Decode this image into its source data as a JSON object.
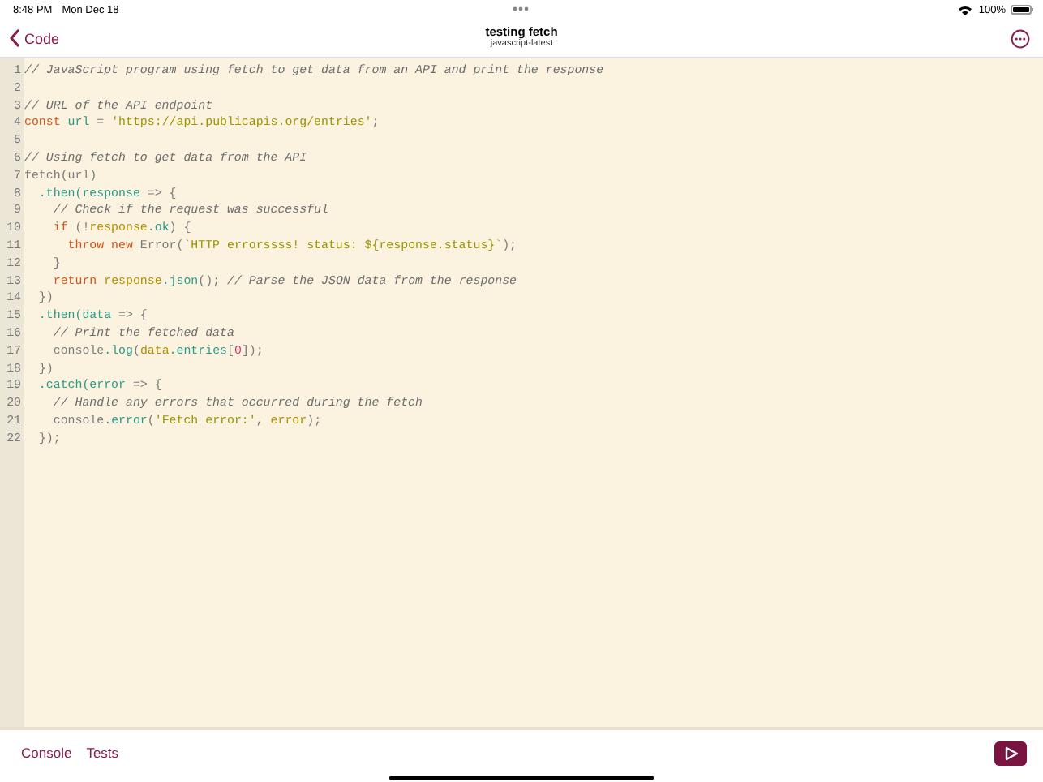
{
  "status_bar": {
    "time": "8:48 PM",
    "date": "Mon Dec 18",
    "battery": "100%"
  },
  "nav": {
    "back_label": "Code",
    "title": "testing fetch",
    "subtitle": "javascript-latest"
  },
  "editor": {
    "lines": [
      {
        "number": "1",
        "tokens": [
          {
            "kind": "comment",
            "text": "// JavaScript program using fetch to get data from an API and print the response"
          }
        ]
      },
      {
        "number": "2"
      },
      {
        "number": "3",
        "tokens": [
          {
            "kind": "comment",
            "text": "// URL of the API endpoint"
          }
        ]
      },
      {
        "number": "4",
        "tokens": [
          {
            "kind": "keyword",
            "text": "const"
          },
          {
            "kind": "member",
            "text": " url"
          },
          {
            "kind": "plain",
            "text": " = "
          },
          {
            "kind": "string",
            "text": "'https://api.publicapis.org/entries'"
          },
          {
            "kind": "plain",
            "text": ";"
          }
        ]
      },
      {
        "number": "5"
      },
      {
        "number": "6",
        "tokens": [
          {
            "kind": "comment",
            "text": "// Using fetch to get data from the API"
          }
        ]
      },
      {
        "number": "7",
        "tokens": [
          {
            "kind": "plain",
            "text": "fetch(url)"
          }
        ]
      },
      {
        "number": "8",
        "tokens": [
          {
            "kind": "member",
            "text": "  .then(response"
          },
          {
            "kind": "plain",
            "text": " => {"
          }
        ]
      },
      {
        "number": "9",
        "tokens": [
          {
            "kind": "comment",
            "text": "    // Check if the request was successful"
          }
        ]
      },
      {
        "number": "10",
        "tokens": [
          {
            "kind": "keyword",
            "text": "    if"
          },
          {
            "kind": "plain",
            "text": " (!"
          },
          {
            "kind": "variable",
            "text": "response"
          },
          {
            "kind": "member",
            "text": ".ok"
          },
          {
            "kind": "plain",
            "text": ") {"
          }
        ]
      },
      {
        "number": "11",
        "tokens": [
          {
            "kind": "keyword",
            "text": "      throw new"
          },
          {
            "kind": "plain",
            "text": " Error("
          },
          {
            "kind": "string",
            "text": "`HTTP errorssss! status: ${response.status}`"
          },
          {
            "kind": "plain",
            "text": ");"
          }
        ]
      },
      {
        "number": "12",
        "tokens": [
          {
            "kind": "plain",
            "text": "    }"
          }
        ]
      },
      {
        "number": "13",
        "tokens": [
          {
            "kind": "keyword",
            "text": "    return"
          },
          {
            "kind": "variable",
            "text": " response"
          },
          {
            "kind": "member",
            "text": ".json"
          },
          {
            "kind": "plain",
            "text": "();"
          },
          {
            "kind": "comment",
            "text": " // Parse the JSON data from the response"
          }
        ]
      },
      {
        "number": "14",
        "tokens": [
          {
            "kind": "plain",
            "text": "  })"
          }
        ]
      },
      {
        "number": "15",
        "tokens": [
          {
            "kind": "member",
            "text": "  .then(data"
          },
          {
            "kind": "plain",
            "text": " => {"
          }
        ]
      },
      {
        "number": "16",
        "tokens": [
          {
            "kind": "comment",
            "text": "    // Print the fetched data"
          }
        ]
      },
      {
        "number": "17",
        "tokens": [
          {
            "kind": "plain",
            "text": "    console"
          },
          {
            "kind": "member",
            "text": ".log"
          },
          {
            "kind": "plain",
            "text": "("
          },
          {
            "kind": "variable",
            "text": "data"
          },
          {
            "kind": "member",
            "text": ".entries"
          },
          {
            "kind": "plain",
            "text": "["
          },
          {
            "kind": "number",
            "text": "0"
          },
          {
            "kind": "plain",
            "text": "]);"
          }
        ]
      },
      {
        "number": "18",
        "tokens": [
          {
            "kind": "plain",
            "text": "  })"
          }
        ]
      },
      {
        "number": "19",
        "tokens": [
          {
            "kind": "member",
            "text": "  .catch(error"
          },
          {
            "kind": "plain",
            "text": " => {"
          }
        ]
      },
      {
        "number": "20",
        "tokens": [
          {
            "kind": "comment",
            "text": "    // Handle any errors that occurred during the fetch"
          }
        ]
      },
      {
        "number": "21",
        "tokens": [
          {
            "kind": "plain",
            "text": "    console"
          },
          {
            "kind": "member",
            "text": ".error"
          },
          {
            "kind": "plain",
            "text": "("
          },
          {
            "kind": "string",
            "text": "'Fetch error:'"
          },
          {
            "kind": "plain",
            "text": ", "
          },
          {
            "kind": "variable",
            "text": "error"
          },
          {
            "kind": "plain",
            "text": ");"
          }
        ]
      },
      {
        "number": "22",
        "tokens": [
          {
            "kind": "plain",
            "text": "  });"
          }
        ]
      }
    ]
  },
  "bottom_bar": {
    "tabs": [
      {
        "label": "Console"
      },
      {
        "label": "Tests"
      }
    ]
  }
}
